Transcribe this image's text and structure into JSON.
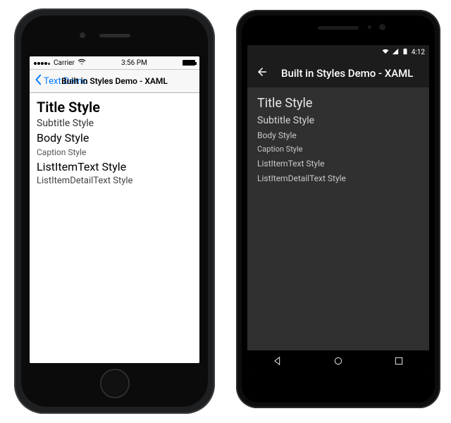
{
  "ios": {
    "status": {
      "carrier": "Carrier",
      "wifi_icon": "wifi-icon",
      "time": "3:56 PM",
      "battery_icon": "battery-icon"
    },
    "nav": {
      "back_label": "Text Demo",
      "title": "Built in Styles Demo - XAML"
    },
    "styles": {
      "title": "Title Style",
      "subtitle": "Subtitle Style",
      "body": "Body Style",
      "caption": "Caption Style",
      "listitem": "ListItemText Style",
      "listitemdetail": "ListItemDetailText Style"
    }
  },
  "android": {
    "status": {
      "time": "4:12"
    },
    "toolbar": {
      "title": "Built in Styles Demo - XAML"
    },
    "styles": {
      "title": "Title Style",
      "subtitle": "Subtitle Style",
      "body": "Body Style",
      "caption": "Caption Style",
      "listitem": "ListItemText Style",
      "listitemdetail": "ListItemDetailText Style"
    }
  }
}
